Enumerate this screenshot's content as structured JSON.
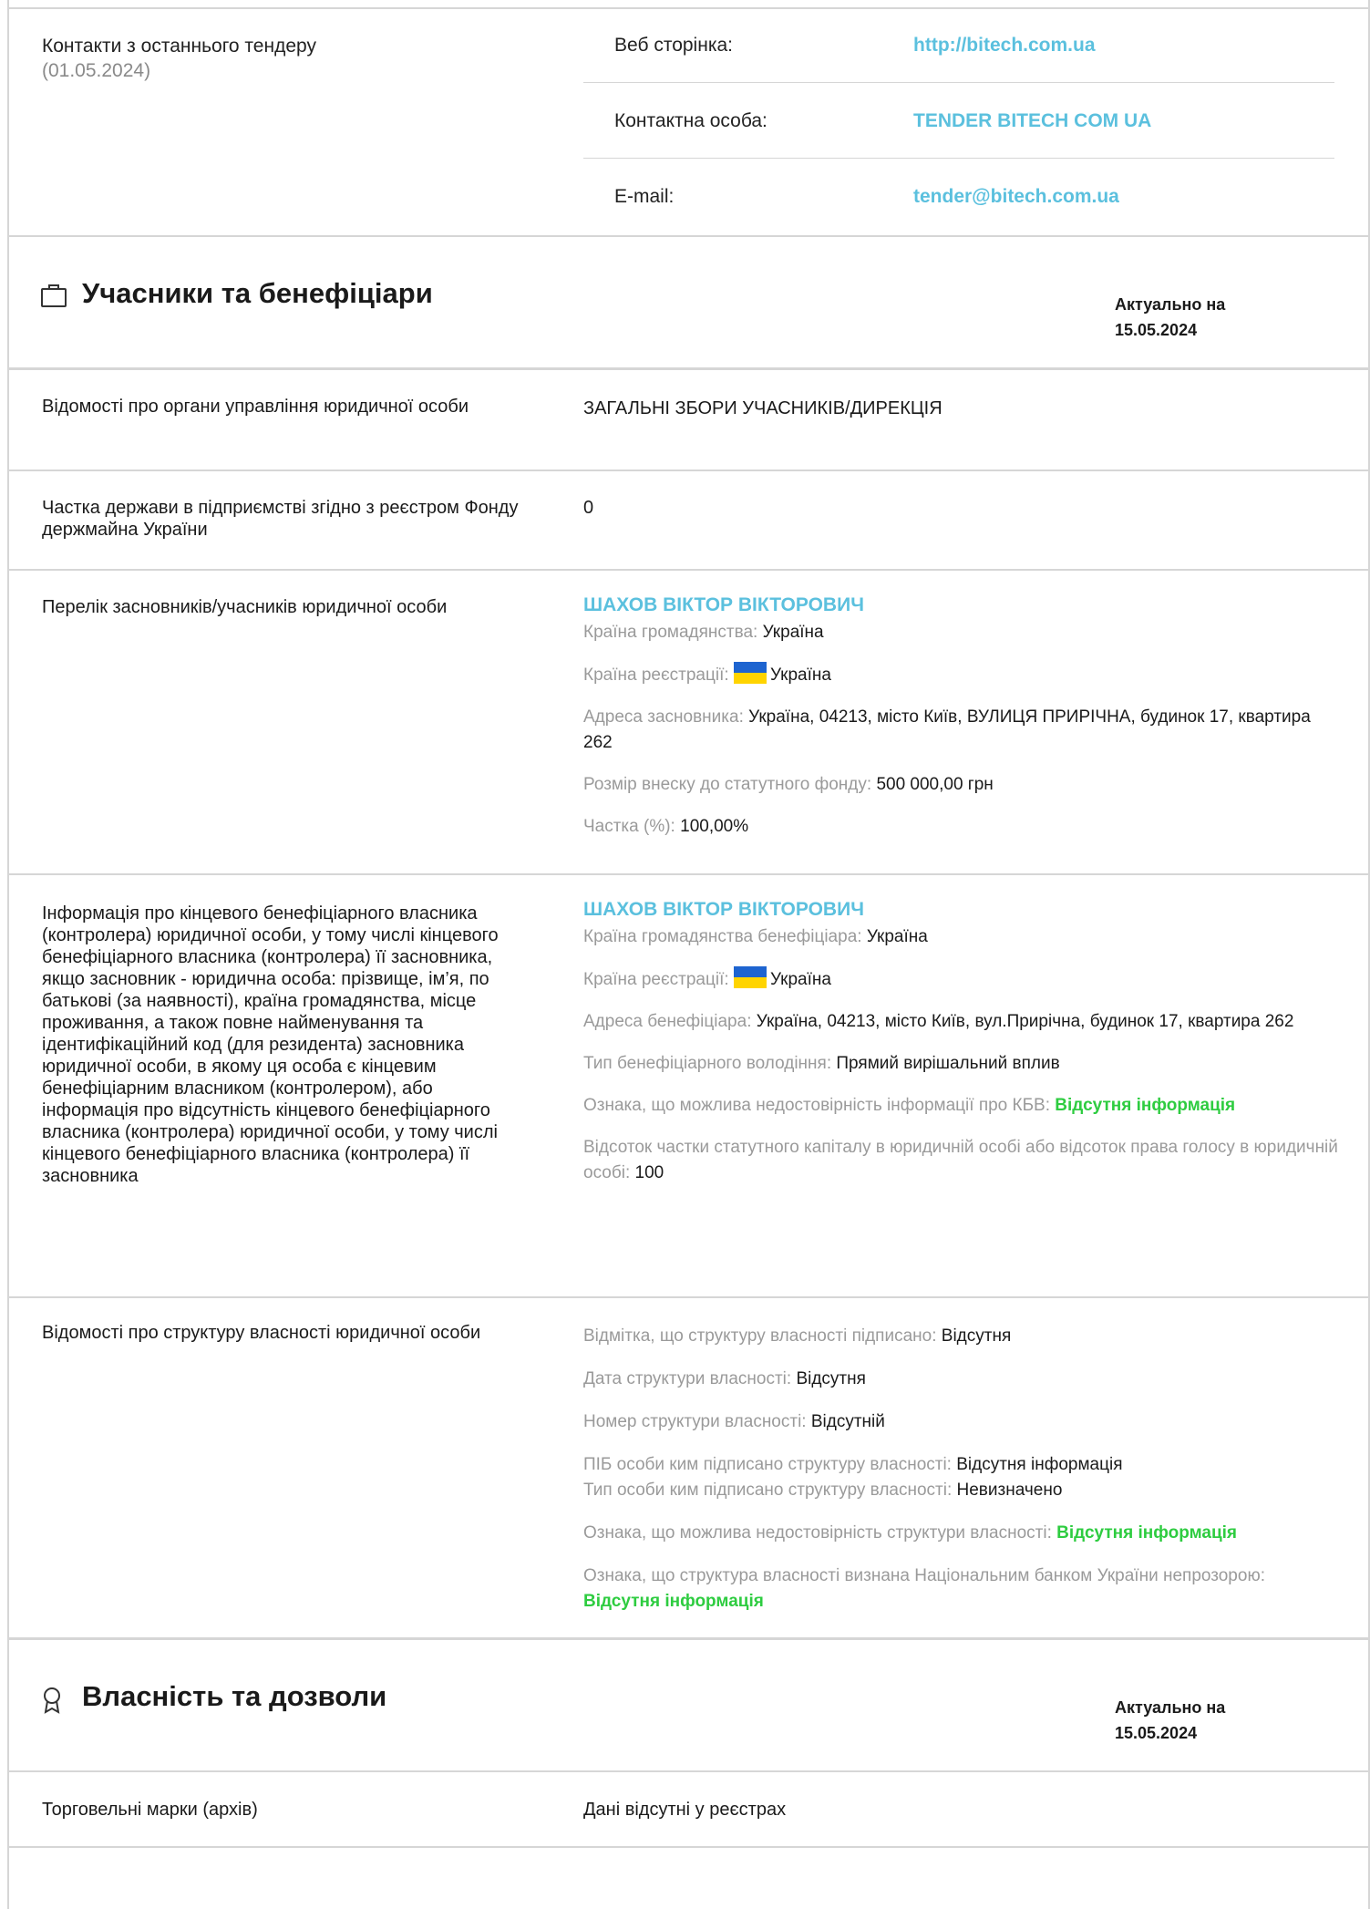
{
  "contacts": {
    "label": "Контакти з останнього тендеру",
    "date": "(01.05.2024)",
    "rows": [
      {
        "key": "Веб сторінка:",
        "value": "http://bitech.com.ua"
      },
      {
        "key": "Контактна особа:",
        "value": "TENDER BITECH COM UA"
      },
      {
        "key": "E-mail:",
        "value": "tender@bitech.com.ua"
      }
    ]
  },
  "participants": {
    "title": "Учасники та бенефіціари",
    "actual_label": "Актуально на",
    "actual_date": "15.05.2024",
    "icon": "briefcase-icon",
    "rows": {
      "management": {
        "label": "Відомості про органи управління юридичної особи",
        "value": "ЗАГАЛЬНІ ЗБОРИ УЧАСНИКІВ/ДИРЕКЦІЯ"
      },
      "state_share": {
        "label": "Частка держави в підприємстві згідно з реєстром Фонду держмайна України",
        "value": "0"
      },
      "founders": {
        "label": "Перелік засновників/учасників юридичної особи",
        "name": "ШАХОВ ВІКТОР ВІКТОРОВИЧ",
        "citizenship_key": "Країна громадянства:",
        "citizenship_val": "Україна",
        "registration_key": "Країна реєстрації:",
        "registration_val": "Україна",
        "address_key": "Адреса засновника:",
        "address_val": "Україна, 04213, місто Київ, ВУЛИЦЯ ПРИРІЧНА, будинок 17, квартира 262",
        "contribution_key": "Розмір внеску до статутного фонду:",
        "contribution_val": "500 000,00 грн",
        "share_key": "Частка (%):",
        "share_val": "100,00%"
      },
      "beneficiary": {
        "label": "Інформація про кінцевого бенефіціарного власника (контролера) юридичної особи, у тому числі кінцевого бенефіціарного власника (контролера) її засновника, якщо засновник - юридична особа: прізвище, ім’я, по батькові (за наявності), країна громадянства, місце проживання, а також повне найменування та ідентифікаційний код (для резидента) засновника юридичної особи, в якому ця особа є кінцевим бенефіціарним власником (контролером), або інформація про відсутність кінцевого бенефіціарного власника (контролера) юридичної особи, у тому числі кінцевого бенефіціарного власника (контролера) її засновника",
        "name": "ШАХОВ ВІКТОР ВІКТОРОВИЧ",
        "citizenship_key": "Країна громадянства бенефіціара:",
        "citizenship_val": "Україна",
        "registration_key": "Країна реєстрації:",
        "registration_val": "Україна",
        "address_key": "Адреса бенефіціара:",
        "address_val": "Україна, 04213, місто Київ, вул.Прирічна, будинок 17, квартира 262",
        "type_key": "Тип бенефіціарного володіння:",
        "type_val": "Прямий вирішальний вплив",
        "unreliable_key": "Ознака, що можлива недостовірність інформації про КБВ:",
        "unreliable_val": "Відсутня інформація",
        "percent_key": "Відсоток частки статутного капіталу в юридичній особі або відсоток права голосу в юридичній особі:",
        "percent_val": "100"
      },
      "ownership": {
        "label": "Відомості про структуру власності юридичної особи",
        "signed_key": "Відмітка, що структуру власності підписано:",
        "signed_val": "Відсутня",
        "date_key": "Дата структури власності:",
        "date_val": "Відсутня",
        "number_key": "Номер структури власності:",
        "number_val": "Відсутній",
        "signer_key": "ПІБ особи ким підписано структуру власності:",
        "signer_val": "Відсутня інформація",
        "signer_type_key": "Тип особи ким підписано структуру власності:",
        "signer_type_val": "Невизначено",
        "unreliable_key": "Ознака, що можлива недостовірність структури власності:",
        "unreliable_val": "Відсутня інформація",
        "opaque_key": "Ознака, що структура власності визнана Національним банком України непрозорою:",
        "opaque_val": "Відсутня інформація"
      }
    }
  },
  "property": {
    "title": "Власність та дозволи",
    "actual_label": "Актуально на",
    "actual_date": "15.05.2024",
    "icon": "award-icon",
    "trademarks_label": "Торговельні марки (архів)",
    "trademarks_value": "Дані відсутні у реєстрах"
  },
  "colors": {
    "link": "#5bc0de",
    "green": "#2ecc40",
    "border": "#d6d6d6",
    "muted": "#9a9a9a"
  }
}
